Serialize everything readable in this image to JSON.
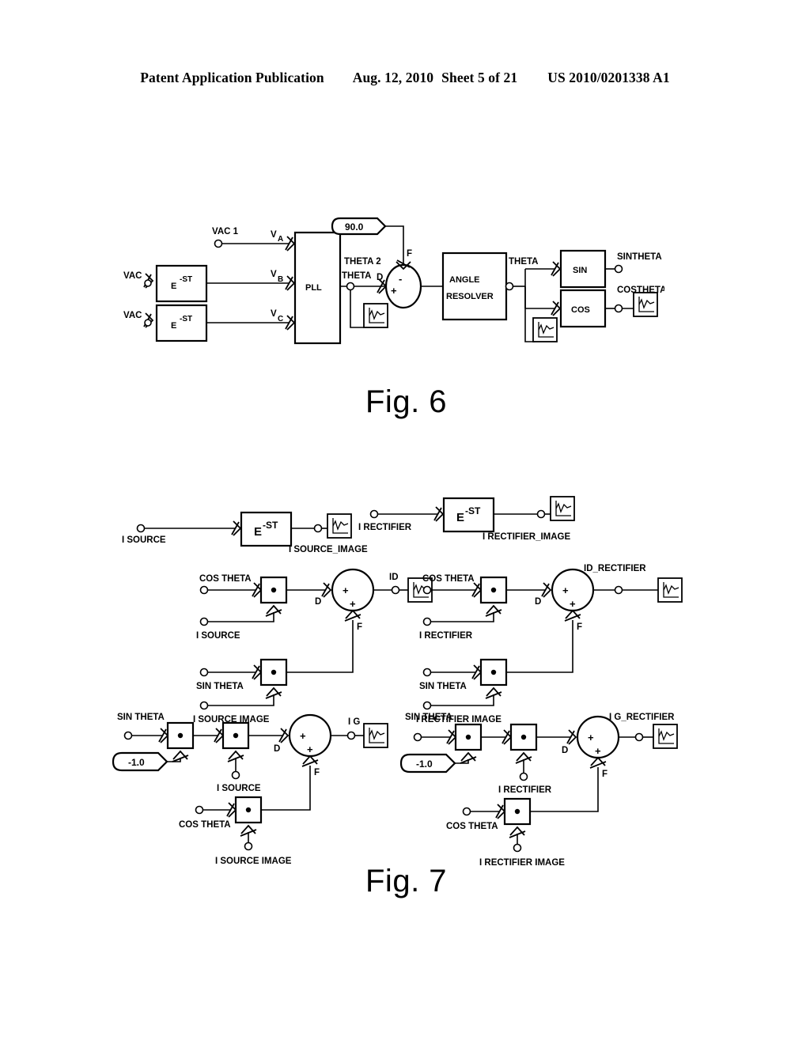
{
  "header": {
    "publication": "Patent Application Publication",
    "date": "Aug. 12, 2010",
    "sheet": "Sheet 5 of 21",
    "number": "US 2010/0201338 A1"
  },
  "captions": {
    "fig6": "Fig. 6",
    "fig7": "Fig. 7"
  },
  "fig6": {
    "title": "Fig. 6",
    "inputs": [
      {
        "id": "vac1",
        "label": "VAC 1",
        "port": "V",
        "port_sub": "A"
      },
      {
        "id": "vac_b",
        "label": "VAC",
        "port": "V",
        "port_sub": "B"
      },
      {
        "id": "vac_c",
        "label": "VAC",
        "port": "V",
        "port_sub": "C"
      }
    ],
    "blocks": [
      {
        "id": "delay_b",
        "label": "E",
        "sup": "-ST",
        "type": "transport-delay"
      },
      {
        "id": "delay_c",
        "label": "E",
        "sup": "-ST",
        "type": "transport-delay"
      },
      {
        "id": "pll",
        "label": "PLL",
        "type": "pll"
      },
      {
        "id": "angle_resolver",
        "label1": "ANGLE",
        "label2": "RESOLVER",
        "type": "angle-resolver"
      },
      {
        "id": "sin",
        "label": "SIN",
        "type": "trig"
      },
      {
        "id": "cos",
        "label": "COS",
        "type": "trig"
      }
    ],
    "constant": {
      "id": "const90",
      "value": "90.0"
    },
    "summer": {
      "id": "summer6",
      "input_d": "D",
      "input_f": "F",
      "sign_d": "+",
      "sign_f": "-"
    },
    "signals": {
      "theta2": "THETA 2",
      "theta_pll": "THETA",
      "theta_out": "THETA",
      "sintheta": "SINTHETA",
      "costheta": "COSTHETA"
    },
    "scopes": [
      "scope-theta-pll",
      "scope-theta-resolved",
      "scope-costheta"
    ]
  },
  "fig7": {
    "title": "Fig. 7",
    "row_top": {
      "left": {
        "input": "I SOURCE",
        "block": {
          "label": "E",
          "sup": "-ST"
        },
        "output": "I SOURCE_IMAGE",
        "scope": "scope-i-source-image"
      },
      "right": {
        "input": "I RECTIFIER",
        "block": {
          "label": "E",
          "sup": "-ST"
        },
        "output": "I RECTIFIER_IMAGE",
        "scope": "scope-i-rectifier-image"
      }
    },
    "row_mid": {
      "left": {
        "in1": "COS THETA",
        "in2": "I SOURCE",
        "in3": "SIN THETA",
        "in4": "I SOURCE IMAGE",
        "sum_d": "D",
        "sum_f": "F",
        "sign_d": "+",
        "sign_f": "+",
        "output": "ID",
        "scope": "scope-id"
      },
      "right": {
        "in1": "COS THETA",
        "in2": "I RECTIFIER",
        "in3": "SIN THETA",
        "in4": "I RECTIFIER IMAGE",
        "sum_d": "D",
        "sum_f": "F",
        "sign_d": "+",
        "sign_f": "+",
        "output": "ID_RECTIFIER",
        "scope": "scope-id-rectifier"
      }
    },
    "row_bot": {
      "left": {
        "in1": "SIN THETA",
        "const": "-1.0",
        "in2": "I SOURCE",
        "in3": "COS THETA",
        "in4": "I SOURCE IMAGE",
        "sum_d": "D",
        "sum_f": "F",
        "sign_d": "+",
        "sign_f": "+",
        "output": "I G",
        "scope": "scope-ig"
      },
      "right": {
        "in1": "SIN THETA",
        "const": "-1.0",
        "in2": "I RECTIFIER",
        "in3": "COS THETA",
        "in4": "I RECTIFIER IMAGE",
        "sum_d": "D",
        "sum_f": "F",
        "sign_d": "+",
        "sign_f": "+",
        "output": "I G_RECTIFIER",
        "scope": "scope-ig-rectifier"
      }
    }
  },
  "colors": {
    "ink": "#000000",
    "paper": "#ffffff"
  }
}
